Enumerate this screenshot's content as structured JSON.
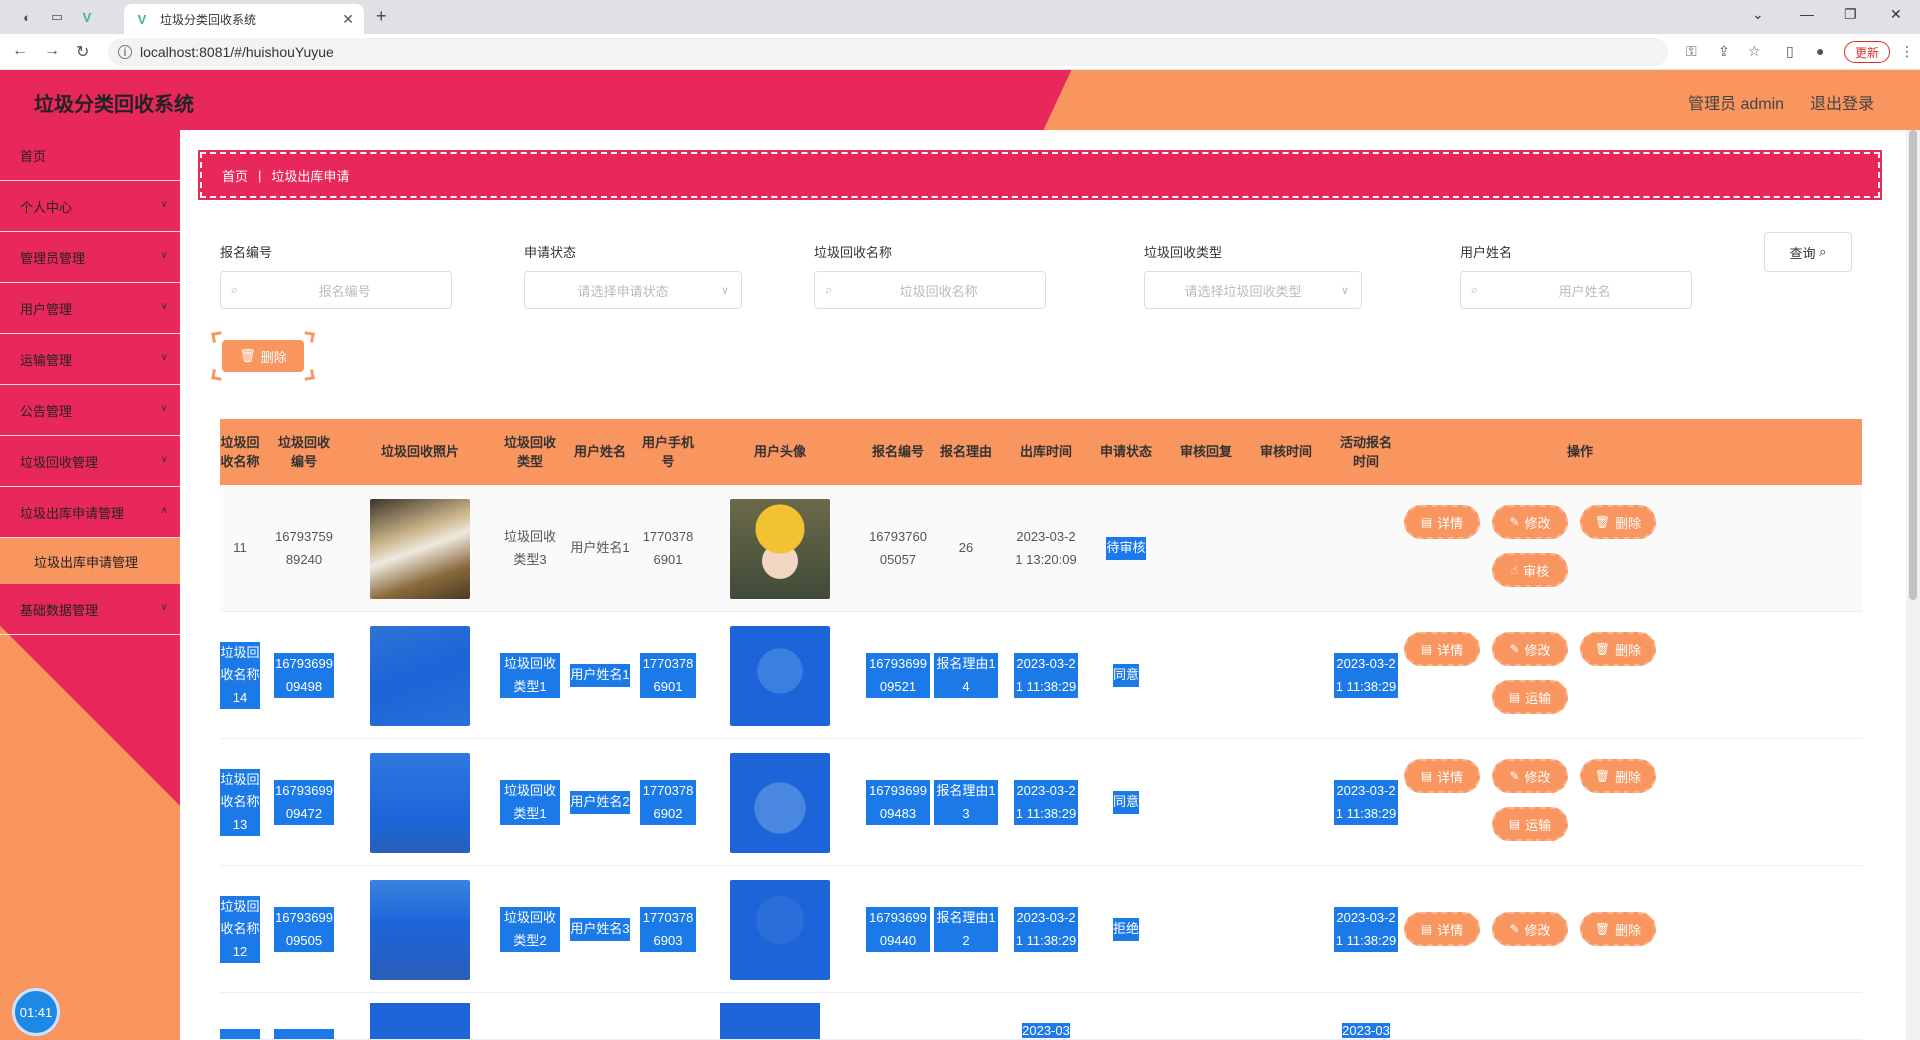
{
  "browser": {
    "tab_title": "垃圾分类回收系统",
    "url": "localhost:8081/#/huishouYuyue",
    "update_label": "更新"
  },
  "header": {
    "title": "垃圾分类回收系统",
    "user": "管理员 admin",
    "logout": "退出登录"
  },
  "sidebar": {
    "items": [
      "首页",
      "个人中心",
      "管理员管理",
      "用户管理",
      "运输管理",
      "公告管理",
      "垃圾回收管理",
      "垃圾出库申请管理"
    ],
    "subitem": "垃圾出库申请管理",
    "last_item": "基础数据管理",
    "timer": "01:41"
  },
  "breadcrumb": {
    "home": "首页",
    "current": "垃圾出库申请"
  },
  "filters": {
    "f1_label": "报名编号",
    "f1_ph": "报名编号",
    "f2_label": "申请状态",
    "f2_ph": "请选择申请状态",
    "f3_label": "垃圾回收名称",
    "f3_ph": "垃圾回收名称",
    "f4_label": "垃圾回收类型",
    "f4_ph": "请选择垃圾回收类型",
    "f5_label": "用户姓名",
    "f5_ph": "用户姓名",
    "query": "查询"
  },
  "toolbar": {
    "delete": "删除"
  },
  "table": {
    "headers": [
      "垃圾回收名称",
      "垃圾回收编号",
      "垃圾回收照片",
      "垃圾回收类型",
      "用户姓名",
      "用户手机号",
      "用户头像",
      "报名编号",
      "报名理由",
      "出库时间",
      "申请状态",
      "审核回复",
      "审核时间",
      "活动报名时间",
      "操作"
    ],
    "actions": {
      "detail": "详情",
      "edit": "修改",
      "delete": "删除",
      "audit": "审核",
      "transport": "运输"
    },
    "rows": [
      {
        "name": "11",
        "code": "1679375989240",
        "type": "垃圾回收类型3",
        "user": "用户姓名1",
        "phone": "17703786901",
        "apply_no": "1679376005057",
        "reason": "26",
        "out_time": "2023-03-21 13:20:09",
        "status": "待审核",
        "reply": "",
        "audit_time": "",
        "signup_time": ""
      },
      {
        "name": "垃圾回收名称14",
        "code": "1679369909498",
        "type": "垃圾回收类型1",
        "user": "用户姓名1",
        "phone": "17703786901",
        "apply_no": "1679369909521",
        "reason": "报名理由14",
        "out_time": "2023-03-21 11:38:29",
        "status": "同意",
        "reply": "",
        "audit_time": "",
        "signup_time": "2023-03-21 11:38:29"
      },
      {
        "name": "垃圾回收名称13",
        "code": "1679369909472",
        "type": "垃圾回收类型1",
        "user": "用户姓名2",
        "phone": "17703786902",
        "apply_no": "1679369909483",
        "reason": "报名理由13",
        "out_time": "2023-03-21 11:38:29",
        "status": "同意",
        "reply": "",
        "audit_time": "",
        "signup_time": "2023-03-21 11:38:29"
      },
      {
        "name": "垃圾回收名称12",
        "code": "1679369909505",
        "type": "垃圾回收类型2",
        "user": "用户姓名3",
        "phone": "17703786903",
        "apply_no": "1679369909440",
        "reason": "报名理由12",
        "out_time": "2023-03-21 11:38:29",
        "status": "拒绝",
        "reply": "",
        "audit_time": "",
        "signup_time": "2023-03-21 11:38:29"
      },
      {
        "out_time": "2023-03",
        "signup_time": "2023-03"
      }
    ]
  },
  "colors": {
    "primary": "#e8285a",
    "secondary": "#f9955f",
    "selection": "#1c7ae8"
  }
}
